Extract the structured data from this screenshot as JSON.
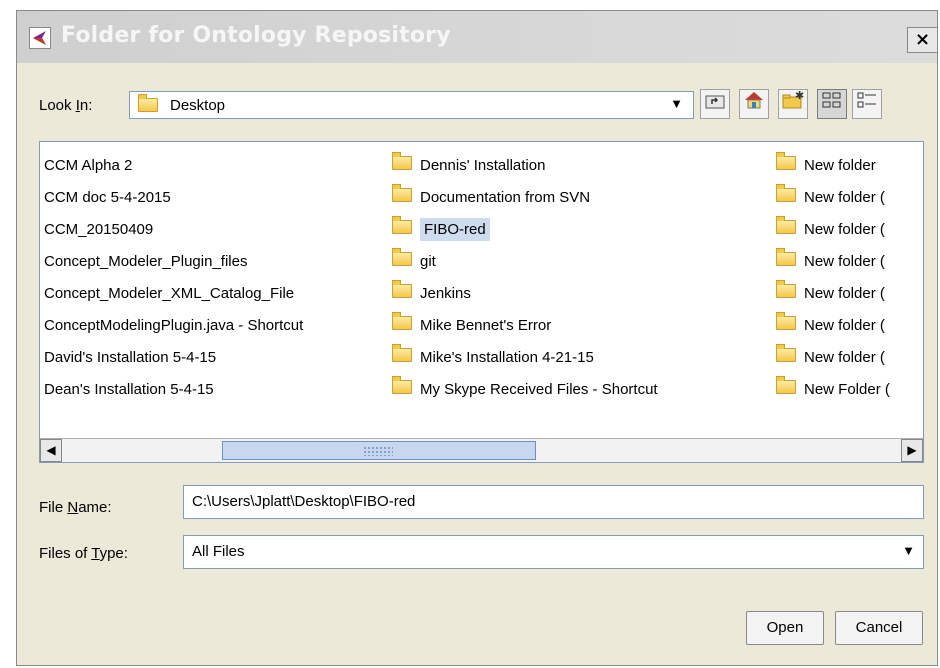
{
  "dialog": {
    "title": "Folder for Ontology Repository",
    "close": "×"
  },
  "look_in": {
    "label_pre": "Look ",
    "label_mnemonic": "I",
    "label_post": "n:",
    "value": "Desktop"
  },
  "toolbar": {
    "up_icon": "folder-up-icon",
    "home_icon": "home-icon",
    "new_folder_icon": "new-folder-icon",
    "list_view_icon": "list-view-icon",
    "details_view_icon": "details-view-icon"
  },
  "files": {
    "col1": [
      "CCM Alpha 2",
      "CCM doc 5-4-2015",
      "CCM_20150409",
      "Concept_Modeler_Plugin_files",
      "Concept_Modeler_XML_Catalog_File",
      "ConceptModelingPlugin.java - Shortcut",
      "David's Installation 5-4-15",
      "Dean's Installation 5-4-15"
    ],
    "col2": [
      "Dennis' Installation",
      "Documentation from SVN",
      "FIBO-red",
      "git",
      "Jenkins",
      "Mike Bennet's Error",
      "Mike's Installation 4-21-15",
      "My Skype Received Files - Shortcut"
    ],
    "col3": [
      "New folder",
      "New folder (",
      "New folder (",
      "New folder (",
      "New folder (",
      "New folder (",
      "New folder (",
      "New Folder ("
    ],
    "selected": "FIBO-red"
  },
  "file_name": {
    "label_pre": "File ",
    "label_mnemonic": "N",
    "label_post": "ame:",
    "value": "C:\\Users\\Jplatt\\Desktop\\FIBO-red"
  },
  "files_of_type": {
    "label_pre": "Files of ",
    "label_mnemonic": "T",
    "label_post": "ype:",
    "value": "All Files"
  },
  "buttons": {
    "open": "Open",
    "cancel": "Cancel"
  },
  "colors": {
    "dialog_bg": "#ece9d8",
    "selection": "#cfdcef",
    "field_border": "#7f9db9"
  }
}
